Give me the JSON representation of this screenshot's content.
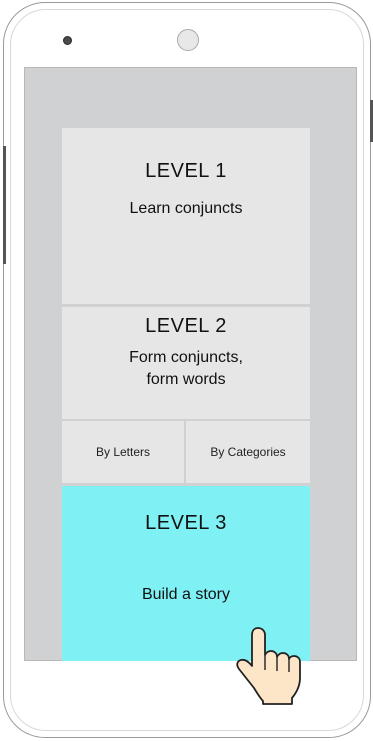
{
  "levels": [
    {
      "title": "LEVEL 1",
      "description": "Learn conjuncts"
    },
    {
      "title": "LEVEL 2",
      "description_line1": "Form conjuncts,",
      "description_line2": "form words"
    },
    {
      "title": "LEVEL 3",
      "description": "Build a story"
    }
  ],
  "level2_options": {
    "by_letters": "By Letters",
    "by_categories": "By Categories"
  },
  "colors": {
    "screen_bg": "#d0d1d3",
    "card_bg": "#e6e6e7",
    "active_card_bg": "#7ff0f4"
  },
  "icons": {
    "pointer": "hand-pointer-icon"
  }
}
